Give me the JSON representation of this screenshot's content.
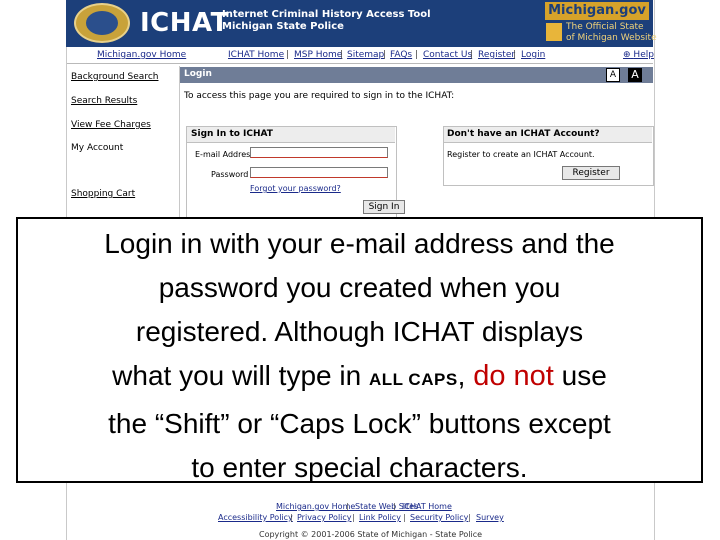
{
  "header": {
    "logo_text": "ICHAT",
    "subtitle_line1": "Internet Criminal History Access Tool",
    "subtitle_line2": "Michigan State Police",
    "michigan_gov": "Michigan.gov",
    "michigan_gov_sub1": "The Official State",
    "michigan_gov_sub2": "of Michigan Website"
  },
  "nav": {
    "items": [
      "Michigan.gov Home",
      "ICHAT Home",
      "MSP Home",
      "Sitemap",
      "FAQs",
      "Contact Us",
      "Register",
      "Login"
    ],
    "help": "Help"
  },
  "sidebar": {
    "items": [
      "Background Search",
      "Search Results",
      "View Fee Charges",
      "My Account",
      "Shopping Cart"
    ]
  },
  "main": {
    "title": "Login",
    "text_size_small": "A",
    "text_size_large": "A",
    "intro": "To access this page you are required to sign in to the ICHAT:",
    "signin": {
      "heading": "Sign In to ICHAT",
      "email_label": "E-mail Address",
      "password_label": "Password",
      "forgot_link": "Forgot your password?",
      "button": "Sign In"
    },
    "register": {
      "heading": "Don't have an ICHAT Account?",
      "text": "Register to create an ICHAT Account.",
      "button": "Register"
    }
  },
  "footer": {
    "row1": [
      "Michigan.gov Home",
      "State Web Sites",
      "ICHAT Home"
    ],
    "row2": [
      "Accessibility Policy",
      "Privacy Policy",
      "Link Policy",
      "Security Policy",
      "Survey"
    ],
    "copyright": "Copyright © 2001-2006 State of Michigan - State Police"
  },
  "overlay": {
    "line1": "Login in with your e-mail address and the",
    "line2": "password you created when you",
    "line3": "registered.  Although ICHAT displays",
    "line4_a": "what you will type in ",
    "line4_caps": "ALL CAPS",
    "line4_b": ", ",
    "line4_emph": "do not",
    "line4_c": " use",
    "line5": "the “Shift” or “Caps Lock” buttons except",
    "line6": "to enter special characters.",
    "emphasis_color": "#c00000"
  }
}
